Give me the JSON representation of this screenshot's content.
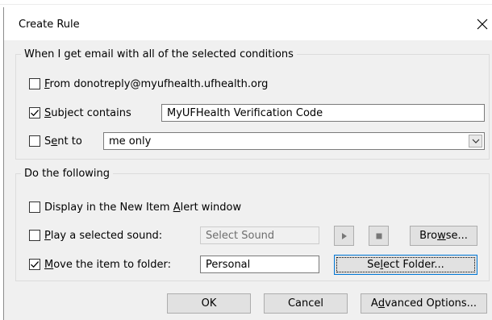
{
  "dialog": {
    "title": "Create Rule"
  },
  "conditions": {
    "legend": "When I get email with all of the selected conditions",
    "from": {
      "checked": false,
      "label_accel": "F",
      "label_rest": "rom donotreply@myufhealth.ufhealth.org"
    },
    "subject": {
      "checked": true,
      "label_accel": "S",
      "label_rest": "ubject contains",
      "value": "MyUFHealth Verification Code"
    },
    "sent_to": {
      "checked": false,
      "label_pre": "S",
      "label_accel": "e",
      "label_rest": "nt to",
      "value": "me only"
    }
  },
  "actions": {
    "legend": "Do the following",
    "alert": {
      "checked": false,
      "label_pre": "Display in the New Item ",
      "label_accel": "A",
      "label_rest": "lert window"
    },
    "sound": {
      "checked": false,
      "label_accel": "P",
      "label_rest": "lay a selected sound:",
      "placeholder": "Select Sound",
      "browse_pre": "Bro",
      "browse_accel": "w",
      "browse_rest": "se..."
    },
    "move": {
      "checked": true,
      "label_accel": "M",
      "label_rest": "ove the item to folder:",
      "value": "Personal",
      "select_pre": "Se",
      "select_accel": "l",
      "select_rest": "ect Folder..."
    }
  },
  "footer": {
    "ok": "OK",
    "cancel": "Cancel",
    "advanced_pre": "A",
    "advanced_accel": "d",
    "advanced_rest": "vanced Options..."
  }
}
